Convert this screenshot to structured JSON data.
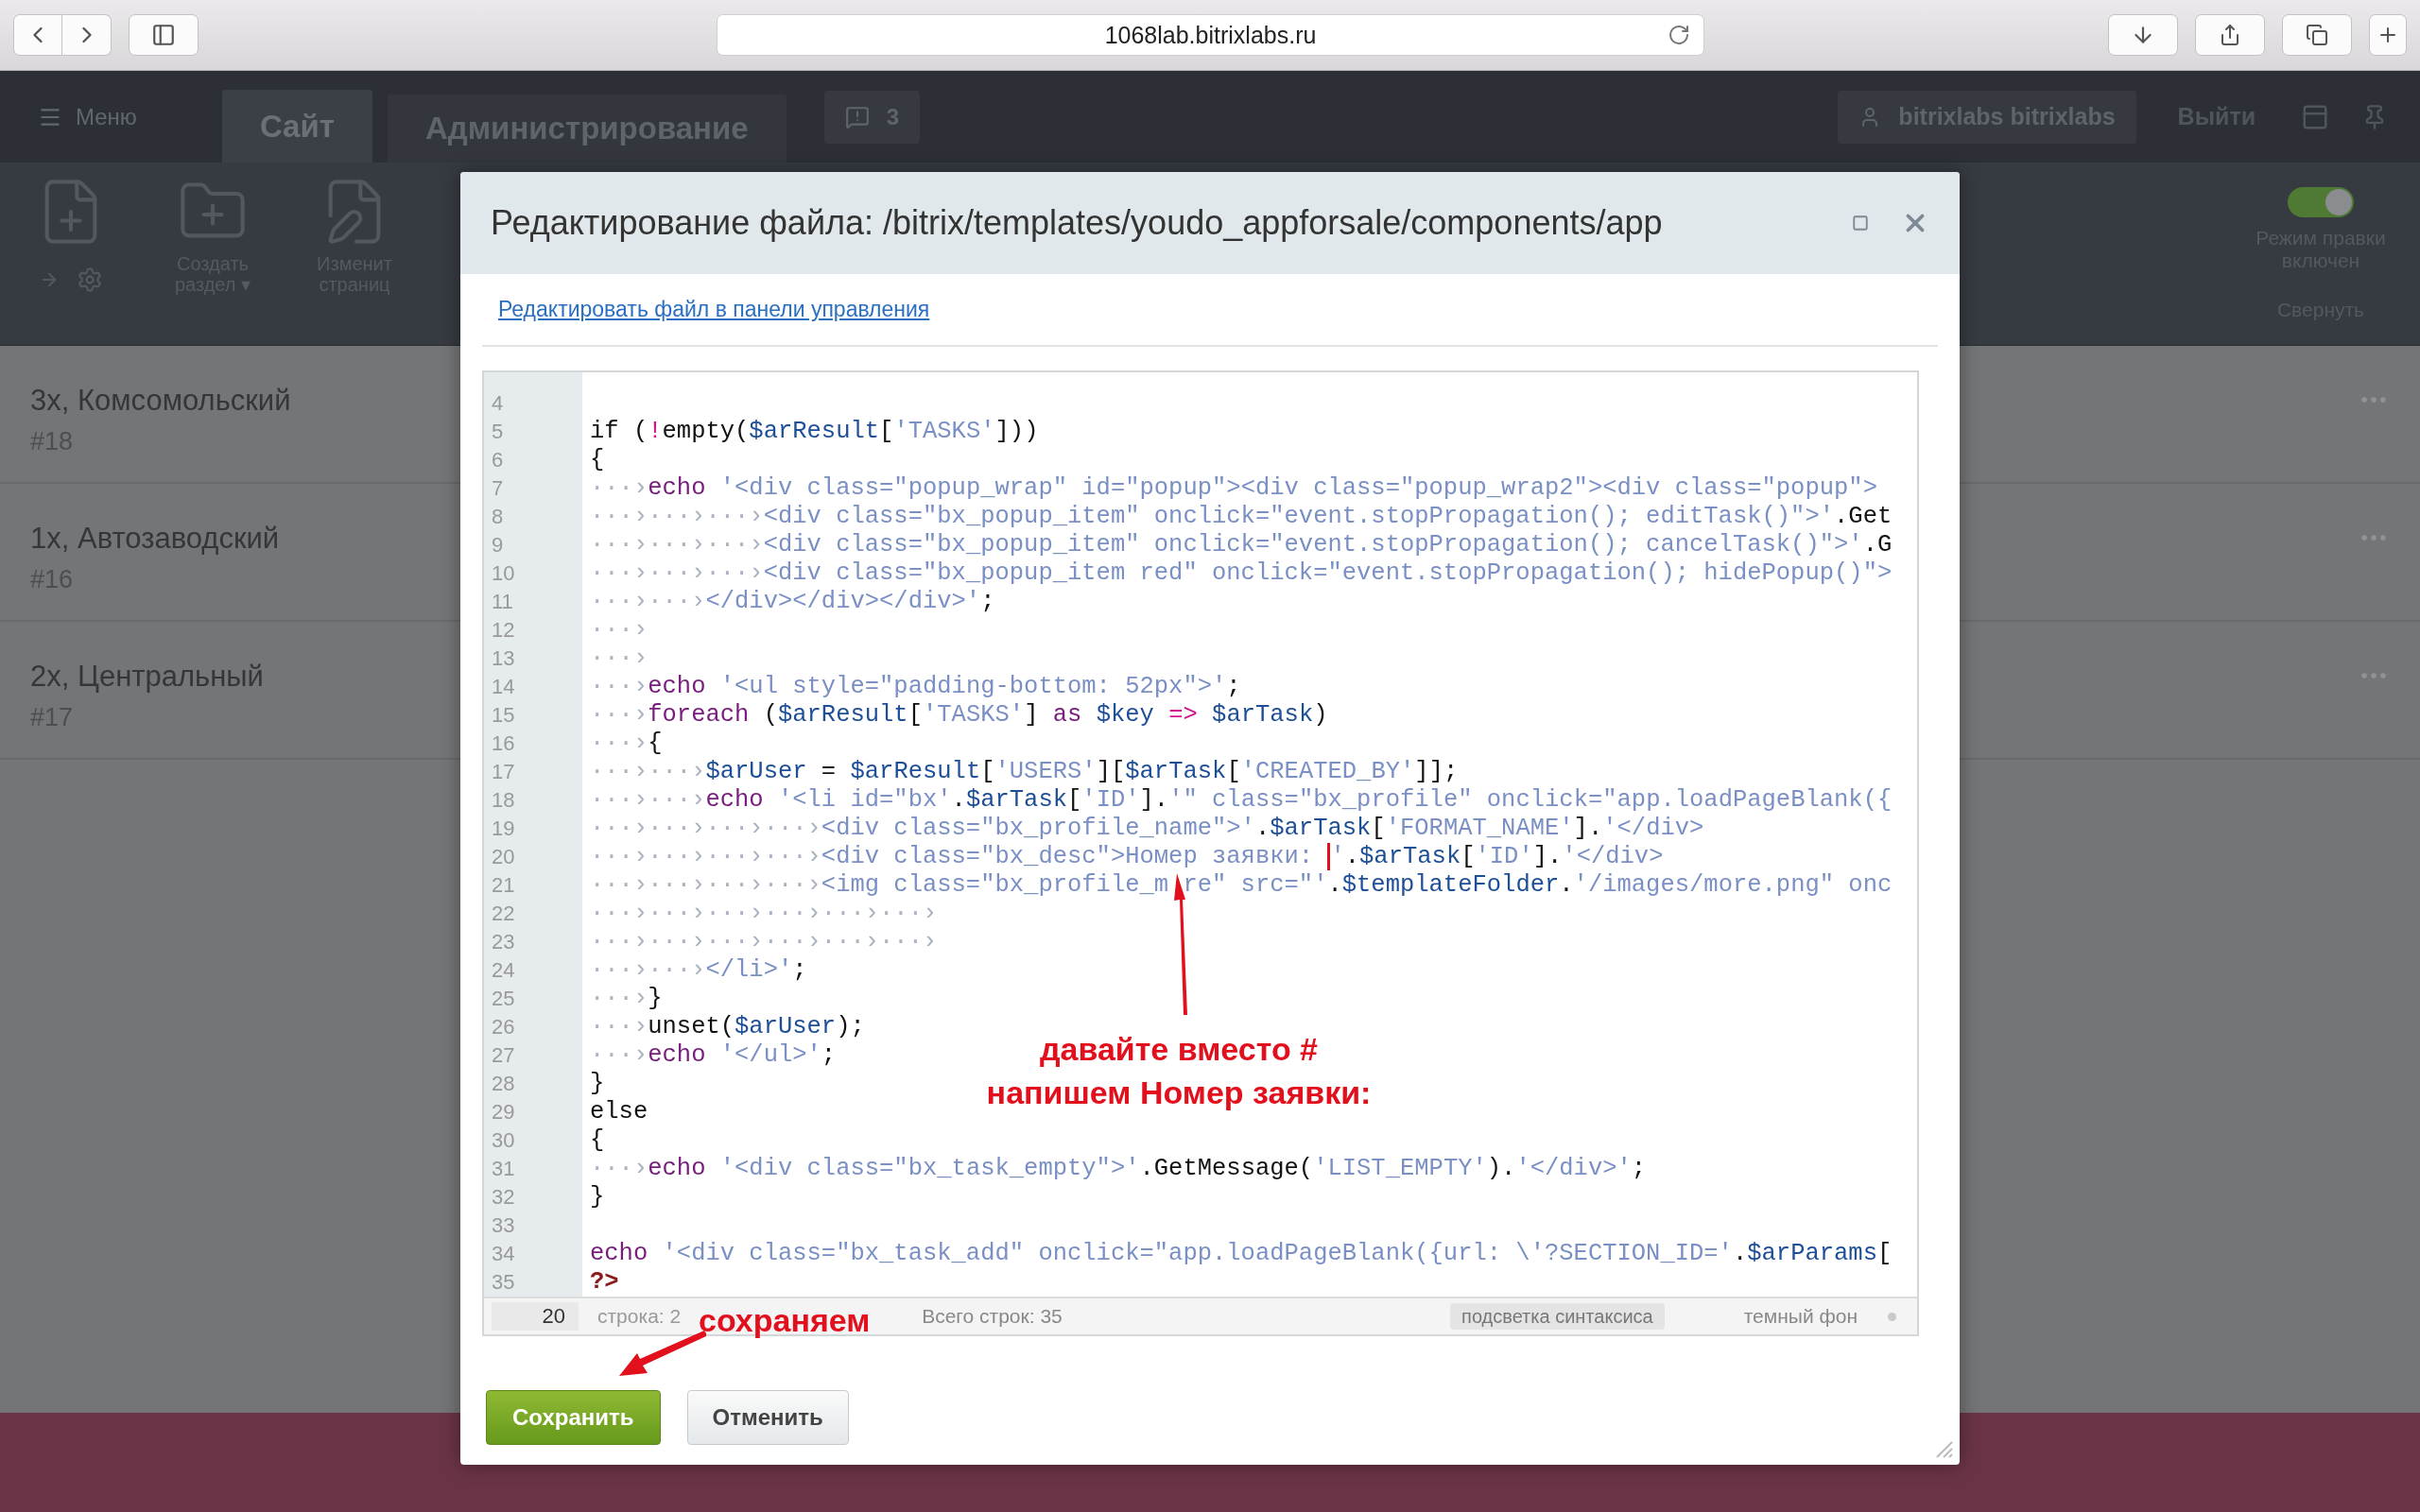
{
  "browser": {
    "url": "1068lab.bitrixlabs.ru"
  },
  "admin_panel": {
    "menu": "Меню",
    "tabs": [
      {
        "label": "Сайт",
        "selected": true
      },
      {
        "label": "Администрирование",
        "selected": false
      }
    ],
    "notifications": "3",
    "user": "bitrixlabs bitrixlabs",
    "logout": "Выйти",
    "tools": [
      {
        "kind": "new-page"
      },
      {
        "kind": "new-folder",
        "label": [
          "Создать",
          "раздел ▾"
        ]
      },
      {
        "kind": "edit-page",
        "label": [
          "Изменит",
          "страниц"
        ]
      }
    ],
    "edit_mode": {
      "on": true,
      "label": [
        "Режим правки",
        "включен"
      ]
    },
    "collapse": "Свернуть"
  },
  "list": [
    {
      "title": "3х, Комсомольский",
      "number": "#18"
    },
    {
      "title": "1х, Автозаводский",
      "number": "#16"
    },
    {
      "title": "2х, Центральный",
      "number": "#17"
    }
  ],
  "dialog": {
    "title": "Редактирование файла: /bitrix/templates/youdo_appforsale/components/app",
    "link": "Редактировать файл в панели управления",
    "lines": [
      {
        "num": "4"
      },
      {
        "num": "5",
        "tokens": [
          {
            "kind": "plain",
            "text": "if ("
          },
          {
            "kind": "operator",
            "text": "!"
          },
          {
            "kind": "plain",
            "text": "empty("
          },
          {
            "kind": "variable",
            "text": "$arResult"
          },
          {
            "kind": "plain",
            "text": "["
          },
          {
            "kind": "string",
            "text": "'TASKS'"
          },
          {
            "kind": "plain",
            "text": "]))"
          }
        ]
      },
      {
        "num": "6",
        "tokens": [
          {
            "kind": "plain",
            "text": "{"
          }
        ]
      },
      {
        "num": "7",
        "indent": "···›",
        "tokens": [
          {
            "kind": "keyword",
            "text": "echo"
          },
          {
            "kind": "string",
            "text": " '<div class=\"popup_wrap\" id=\"popup\"><div class=\"popup_wrap2\"><div class=\"popup\">"
          }
        ]
      },
      {
        "num": "8",
        "indent": "···›···›···›",
        "tokens": [
          {
            "kind": "string",
            "text": "<div class=\"bx_popup_item\" onclick=\"event.stopPropagation(); editTask()\">'"
          },
          {
            "kind": "plain",
            "text": ".Get"
          }
        ]
      },
      {
        "num": "9",
        "indent": "···›···›···›",
        "tokens": [
          {
            "kind": "string",
            "text": "<div class=\"bx_popup_item\" onclick=\"event.stopPropagation(); cancelTask()\">'"
          },
          {
            "kind": "plain",
            "text": ".G"
          }
        ]
      },
      {
        "num": "10",
        "indent": "···›···›···›",
        "tokens": [
          {
            "kind": "string",
            "text": "<div class=\"bx_popup_item red\" onclick=\"event.stopPropagation(); hidePopup()\">"
          }
        ]
      },
      {
        "num": "11",
        "indent": "···›···›",
        "tokens": [
          {
            "kind": "string",
            "text": "</div></div></div>'"
          },
          {
            "kind": "plain",
            "text": ";"
          }
        ]
      },
      {
        "num": "12",
        "indent": "···›"
      },
      {
        "num": "13",
        "indent": "···›"
      },
      {
        "num": "14",
        "indent": "···›",
        "tokens": [
          {
            "kind": "keyword",
            "text": "echo"
          },
          {
            "kind": "string",
            "text": " '<ul style=\"padding-bottom: 52px\">'"
          },
          {
            "kind": "plain",
            "text": ";"
          }
        ]
      },
      {
        "num": "15",
        "indent": "···›",
        "tokens": [
          {
            "kind": "keyword",
            "text": "foreach"
          },
          {
            "kind": "plain",
            "text": " ("
          },
          {
            "kind": "variable",
            "text": "$arResult"
          },
          {
            "kind": "plain",
            "text": "["
          },
          {
            "kind": "string",
            "text": "'TASKS'"
          },
          {
            "kind": "plain",
            "text": "] "
          },
          {
            "kind": "keyword",
            "text": "as"
          },
          {
            "kind": "variable",
            "text": " $key"
          },
          {
            "kind": "operator",
            "text": " =>"
          },
          {
            "kind": "variable",
            "text": " $arTask"
          },
          {
            "kind": "plain",
            "text": ")"
          }
        ]
      },
      {
        "num": "16",
        "indent": "···›",
        "tokens": [
          {
            "kind": "plain",
            "text": "{"
          }
        ]
      },
      {
        "num": "17",
        "indent": "···›···›",
        "tokens": [
          {
            "kind": "variable",
            "text": "$arUser"
          },
          {
            "kind": "plain",
            "text": " = "
          },
          {
            "kind": "variable",
            "text": "$arResult"
          },
          {
            "kind": "plain",
            "text": "["
          },
          {
            "kind": "string",
            "text": "'USERS'"
          },
          {
            "kind": "plain",
            "text": "]["
          },
          {
            "kind": "variable",
            "text": "$arTask"
          },
          {
            "kind": "plain",
            "text": "["
          },
          {
            "kind": "string",
            "text": "'CREATED_BY'"
          },
          {
            "kind": "plain",
            "text": "]];"
          }
        ]
      },
      {
        "num": "18",
        "indent": "···›···›",
        "tokens": [
          {
            "kind": "keyword",
            "text": "echo"
          },
          {
            "kind": "string",
            "text": " '<li id=\"bx'"
          },
          {
            "kind": "plain",
            "text": "."
          },
          {
            "kind": "variable",
            "text": "$arTask"
          },
          {
            "kind": "plain",
            "text": "["
          },
          {
            "kind": "string",
            "text": "'ID'"
          },
          {
            "kind": "plain",
            "text": "]."
          },
          {
            "kind": "string",
            "text": "'\" class=\"bx_profile\" onclick=\"app.loadPageBlank({"
          }
        ]
      },
      {
        "num": "19",
        "indent": "···›···›···›···›",
        "tokens": [
          {
            "kind": "string",
            "text": "<div class=\"bx_profile_name\">'"
          },
          {
            "kind": "plain",
            "text": "."
          },
          {
            "kind": "variable",
            "text": "$arTask"
          },
          {
            "kind": "plain",
            "text": "["
          },
          {
            "kind": "string",
            "text": "'FORMAT_NAME'"
          },
          {
            "kind": "plain",
            "text": "]."
          },
          {
            "kind": "string",
            "text": "'</div>"
          }
        ]
      },
      {
        "num": "20",
        "indent": "···›···›···›···›",
        "tokens": [
          {
            "kind": "string",
            "text": "<div class=\"bx_desc\">Номер заявки: "
          },
          {
            "kind": "caret",
            "text": "'"
          },
          {
            "kind": "plain",
            "text": "."
          },
          {
            "kind": "variable",
            "text": "$arTask"
          },
          {
            "kind": "plain",
            "text": "["
          },
          {
            "kind": "string",
            "text": "'ID'"
          },
          {
            "kind": "plain",
            "text": "]."
          },
          {
            "kind": "string",
            "text": "'</div>"
          }
        ]
      },
      {
        "num": "21",
        "indent": "···›···›···›···›",
        "tokens": [
          {
            "kind": "string",
            "text": "<img class=\"bx_profile_m"
          },
          {
            "kind": "gap"
          },
          {
            "kind": "string",
            "text": "re\" src=\"'"
          },
          {
            "kind": "plain",
            "text": "."
          },
          {
            "kind": "variable",
            "text": "$templateFolder"
          },
          {
            "kind": "plain",
            "text": "."
          },
          {
            "kind": "string",
            "text": "'/images/more.png\" onc"
          }
        ]
      },
      {
        "num": "22",
        "indent": "···›···›···›···›···›···›"
      },
      {
        "num": "23",
        "indent": "···›···›···›···›···›···›"
      },
      {
        "num": "24",
        "indent": "···›···›",
        "tokens": [
          {
            "kind": "string",
            "text": "</li>'"
          },
          {
            "kind": "plain",
            "text": ";"
          }
        ]
      },
      {
        "num": "25",
        "indent": "···›",
        "tokens": [
          {
            "kind": "plain",
            "text": "}"
          }
        ]
      },
      {
        "num": "26",
        "indent": "···›",
        "tokens": [
          {
            "kind": "plain",
            "text": "unset("
          },
          {
            "kind": "variable",
            "text": "$arUser"
          },
          {
            "kind": "plain",
            "text": ");"
          }
        ]
      },
      {
        "num": "27",
        "indent": "···›",
        "tokens": [
          {
            "kind": "keyword",
            "text": "echo"
          },
          {
            "kind": "string",
            "text": " '</ul>'"
          },
          {
            "kind": "plain",
            "text": ";"
          }
        ]
      },
      {
        "num": "28",
        "tokens": [
          {
            "kind": "plain",
            "text": "}"
          }
        ]
      },
      {
        "num": "29",
        "tokens": [
          {
            "kind": "plain",
            "text": "else"
          }
        ]
      },
      {
        "num": "30",
        "tokens": [
          {
            "kind": "plain",
            "text": "{"
          }
        ]
      },
      {
        "num": "31",
        "indent": "···›",
        "tokens": [
          {
            "kind": "keyword",
            "text": "echo"
          },
          {
            "kind": "string",
            "text": " '<div class=\"bx_task_empty\">'"
          },
          {
            "kind": "plain",
            "text": ".GetMessage("
          },
          {
            "kind": "string",
            "text": "'LIST_EMPTY'"
          },
          {
            "kind": "plain",
            "text": ")."
          },
          {
            "kind": "string",
            "text": "'</div>'"
          },
          {
            "kind": "plain",
            "text": ";"
          }
        ]
      },
      {
        "num": "32",
        "tokens": [
          {
            "kind": "plain",
            "text": "}"
          }
        ]
      },
      {
        "num": "33"
      },
      {
        "num": "34",
        "tokens": [
          {
            "kind": "keyword",
            "text": "echo"
          },
          {
            "kind": "string",
            "text": " '<div class=\"bx_task_add\" onclick=\"app.loadPageBlank({url: \\'?SECTION_ID='"
          },
          {
            "kind": "plain",
            "text": "."
          },
          {
            "kind": "variable",
            "text": "$arParams"
          },
          {
            "kind": "plain",
            "text": "["
          }
        ]
      },
      {
        "num": "35",
        "tokens": [
          {
            "kind": "tag",
            "text": "?>"
          }
        ]
      }
    ],
    "status": {
      "line_input": "20",
      "position": "строка: 2",
      "total": "Всего строк: 35",
      "highlight": "подсветка синтаксиса",
      "dark_bg": "темный фон"
    },
    "buttons": [
      {
        "kind": "primary",
        "label": "Сохранить"
      },
      {
        "kind": "secondary",
        "label": "Отменить"
      }
    ],
    "annotations": [
      {
        "kind": "code",
        "text": [
          "давайте вместо #",
          "напишем Номер заявки:"
        ]
      },
      {
        "kind": "save",
        "text": [
          "сохраняем"
        ]
      }
    ]
  }
}
